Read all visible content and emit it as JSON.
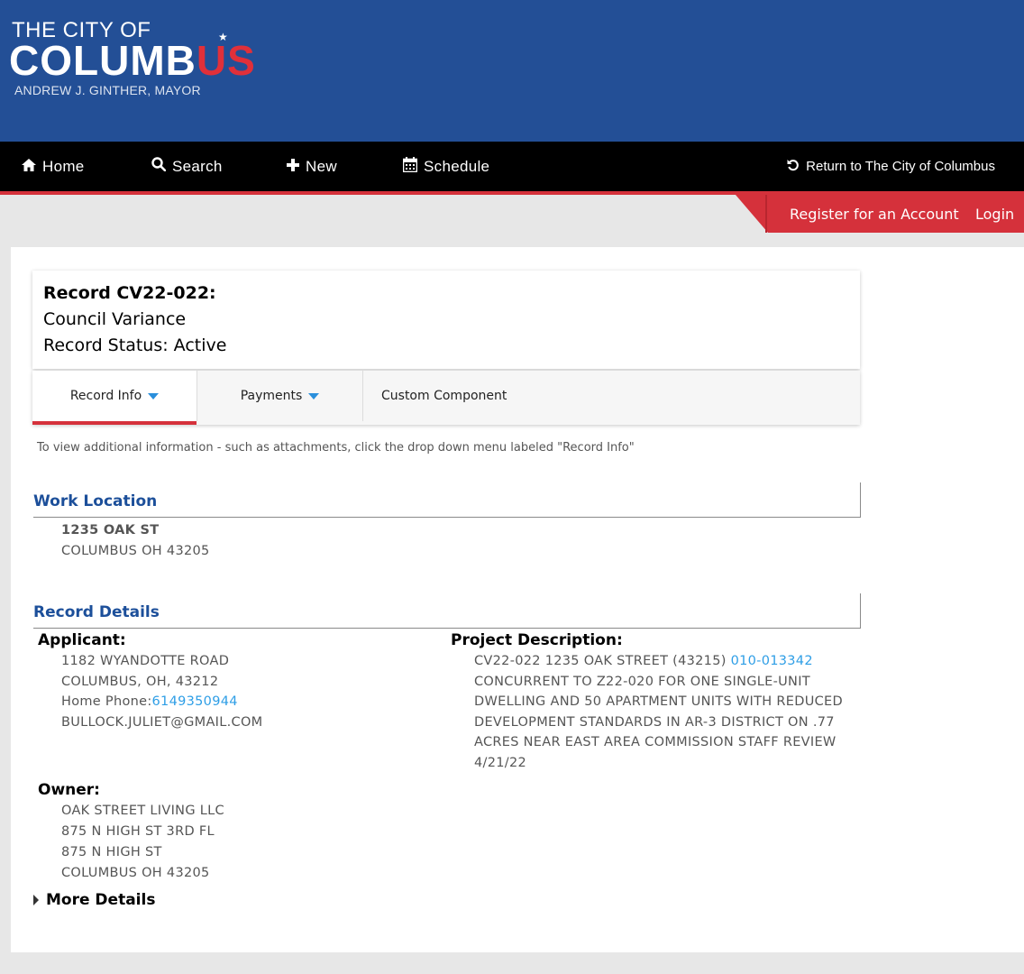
{
  "brand": {
    "line1": "THE CITY OF",
    "line2_main": "COLUMB",
    "line2_accent": "US",
    "line3": "ANDREW J. GINTHER, MAYOR"
  },
  "nav": {
    "home": "Home",
    "search": "Search",
    "new": "New",
    "schedule": "Schedule",
    "return": "Return to The City of Columbus"
  },
  "account": {
    "register": "Register for an Account",
    "login": "Login"
  },
  "record": {
    "title": "Record CV22-022:",
    "type": "Council Variance",
    "status": "Record Status: Active"
  },
  "tabs": {
    "record_info": "Record Info",
    "payments": "Payments",
    "custom": "Custom Component"
  },
  "hint": "To view additional information - such as attachments, click the drop down menu labeled \"Record Info\"",
  "work_location": {
    "title": "Work Location",
    "line1": "1235 OAK ST",
    "line2": "COLUMBUS OH 43205"
  },
  "record_details": {
    "title": "Record Details",
    "applicant": {
      "label": "Applicant:",
      "address1": "1182 WYANDOTTE ROAD",
      "address2": "COLUMBUS, OH, 43212",
      "phone_label": "Home Phone:",
      "phone": "6149350944",
      "email": "BULLOCK.JULIET@GMAIL.COM"
    },
    "owner": {
      "label": "Owner:",
      "line1": "OAK STREET LIVING LLC",
      "line2": "875 N HIGH ST 3RD FL",
      "line3": "875 N HIGH ST",
      "line4": "COLUMBUS OH 43205"
    },
    "project": {
      "label": "Project Description:",
      "line1_pre": "CV22-022 1235 OAK STREET (43215) ",
      "line1_link": "010-013342",
      "line2": "CONCURRENT TO Z22-020 FOR ONE SINGLE-UNIT",
      "line3": "DWELLING AND 50 APARTMENT UNITS WITH REDUCED",
      "line4": "DEVELOPMENT STANDARDS IN AR-3 DISTRICT ON .77",
      "line5": "ACRES NEAR EAST AREA COMMISSION STAFF REVIEW",
      "line6": "4/21/22"
    },
    "more_details": "More Details"
  }
}
